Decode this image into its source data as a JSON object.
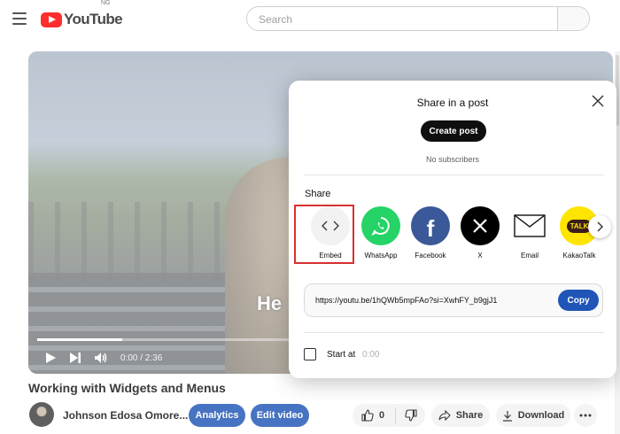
{
  "header": {
    "logo_text": "YouTube",
    "country_code": "NG",
    "search_placeholder": "Search"
  },
  "player": {
    "subtitle": "He",
    "time": "0:00 / 2:36",
    "progress_fraction": 0.32
  },
  "video": {
    "title": "Working with Widgets and Menus",
    "channel": "Johnson Edosa Omore...",
    "analytics_label": "Analytics",
    "edit_label": "Edit video",
    "like_count": "0",
    "share_label": "Share",
    "download_label": "Download"
  },
  "share_dialog": {
    "title": "Share in a post",
    "create_post_label": "Create post",
    "no_subscribers": "No subscribers",
    "share_heading": "Share",
    "targets": [
      {
        "label": "Embed",
        "icon": "embed-icon",
        "bg": "#f2f2f2"
      },
      {
        "label": "WhatsApp",
        "icon": "whatsapp-icon",
        "bg": "#25d366"
      },
      {
        "label": "Facebook",
        "icon": "facebook-icon",
        "bg": "#3b5998"
      },
      {
        "label": "X",
        "icon": "x-icon",
        "bg": "#000000"
      },
      {
        "label": "Email",
        "icon": "email-icon",
        "bg": "#ffffff"
      },
      {
        "label": "KakaoTalk",
        "icon": "kakaotalk-icon",
        "bg": "#fee500"
      }
    ],
    "link": "https://youtu.be/1hQWb5mpFAo?si=XwhFY_b9gjJ1",
    "copy_label": "Copy",
    "start_at_label": "Start at",
    "start_at_value": "0:00"
  },
  "colors": {
    "accent_blue": "#1f55b6",
    "youtube_red": "#ff0000",
    "highlight_red": "#d93030"
  }
}
